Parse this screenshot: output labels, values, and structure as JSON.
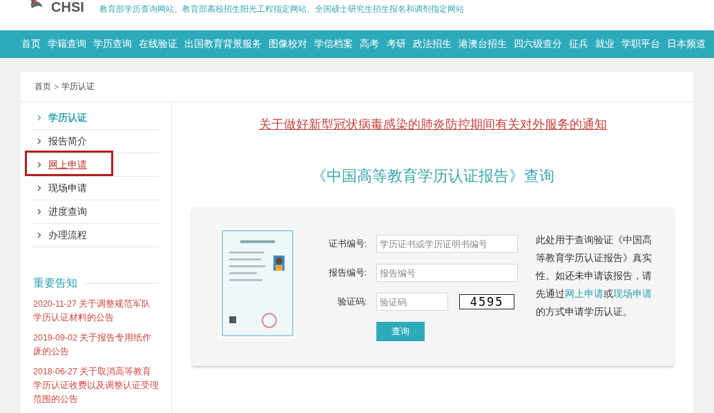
{
  "header": {
    "logo_text": "CHSI",
    "tagline": "教育部学历查询网站、教育部高校招生阳光工程指定网站、全国硕士研究生招生报名和调剂指定网站"
  },
  "nav": [
    "首页",
    "学籍查询",
    "学历查询",
    "在线验证",
    "出国教育背景服务",
    "图像校对",
    "学信档案",
    "高考",
    "考研",
    "政法招生",
    "港澳台招生",
    "四六级查分",
    "征兵",
    "就业",
    "学职平台",
    "日本频道"
  ],
  "breadcrumb": {
    "items": [
      "首页",
      "学历认证"
    ],
    "separator": ">"
  },
  "sidebar": {
    "items": [
      {
        "label": "学历认证",
        "selected": true,
        "highlighted": false
      },
      {
        "label": "报告简介",
        "selected": false,
        "highlighted": false
      },
      {
        "label": "网上申请",
        "selected": false,
        "highlighted": true
      },
      {
        "label": "现场申请",
        "selected": false,
        "highlighted": false
      },
      {
        "label": "进度查询",
        "selected": false,
        "highlighted": false
      },
      {
        "label": "办理流程",
        "selected": false,
        "highlighted": false
      }
    ]
  },
  "notices": {
    "title": "重要告知",
    "items": [
      "2020-11-27 关于调整规范军队学历认证材料的公告",
      "2019-09-02 关于报告专用纸作废的公告",
      "2018-06-27 关于取消高等教育学历认证收费以及调整认证受理范围的公告"
    ]
  },
  "main": {
    "notice_link": "关于做好新型冠状病毒感染的肺炎防控期间有关对外服务的通知",
    "query_title": "《中国高等教育学历认证报告》查询",
    "form": {
      "fields": [
        {
          "kind": "text",
          "label": "证书编号:",
          "placeholder": "学历证书或学历证明书编号"
        },
        {
          "kind": "text",
          "label": "报告编号:",
          "placeholder": "报告编号"
        },
        {
          "kind": "captcha",
          "label": "验证码:",
          "placeholder": "验证码",
          "captcha": "4595"
        }
      ],
      "submit": "查询"
    },
    "description": [
      {
        "kind": "text",
        "text": "此处用于查询验证《中国高等教育学历认证报告》真实性。如还未申请该报告，请先通过"
      },
      {
        "kind": "link",
        "text": "网上申请"
      },
      {
        "kind": "text",
        "text": "或"
      },
      {
        "kind": "link",
        "text": "现场申请"
      },
      {
        "kind": "text",
        "text": "的方式申请学历认证。"
      }
    ]
  }
}
